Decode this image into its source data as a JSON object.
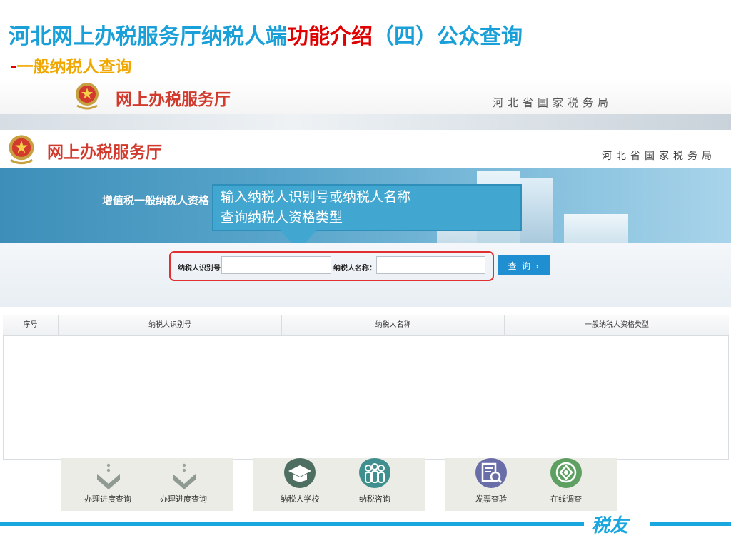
{
  "slide": {
    "title_main": "河北网上办税服务厅纳税人端",
    "title_highlight": "功能介绍",
    "title_tail": "（四）公众查询",
    "subtitle_dash": "-",
    "subtitle": "一般纳税人查询",
    "footer_brand": "税友"
  },
  "back_screenshot": {
    "logo_text": "网上办税服务厅",
    "bureau": "河北省国家税务局"
  },
  "header": {
    "logo_text": "网上办税服务厅",
    "bureau": "河北省国家税务局"
  },
  "hero": {
    "title": "增值税一般纳税人资格"
  },
  "callout": {
    "line1": "输入纳税人识别号或纳税人名称",
    "line2": "查询纳税人资格类型"
  },
  "search": {
    "id_label": "纳税人识别号:",
    "id_value": "",
    "name_label": "纳税人名称：",
    "name_value": "",
    "query_button": "查 询 ›"
  },
  "table": {
    "columns": [
      "序号",
      "纳税人识别号",
      "纳税人名称",
      "一般纳税人资格类型"
    ],
    "rows": []
  },
  "quick_links": [
    {
      "label": "办理进度查询",
      "icon": "progress-chevron-icon"
    },
    {
      "label": "办理进度查询",
      "icon": "progress-chevron-icon"
    },
    {
      "label": "纳税人学校",
      "icon": "graduation-cap-icon"
    },
    {
      "label": "纳税咨询",
      "icon": "people-consult-icon"
    },
    {
      "label": "发票查验",
      "icon": "invoice-search-icon"
    },
    {
      "label": "在线调查",
      "icon": "survey-icon"
    }
  ],
  "colors": {
    "title_blue": "#1aa0d8",
    "title_red": "#e00000",
    "subtitle_orange": "#f0a800",
    "callout_bg": "#42a7d0",
    "highlight_frame": "#e03030",
    "button_blue": "#1f8fd2"
  }
}
